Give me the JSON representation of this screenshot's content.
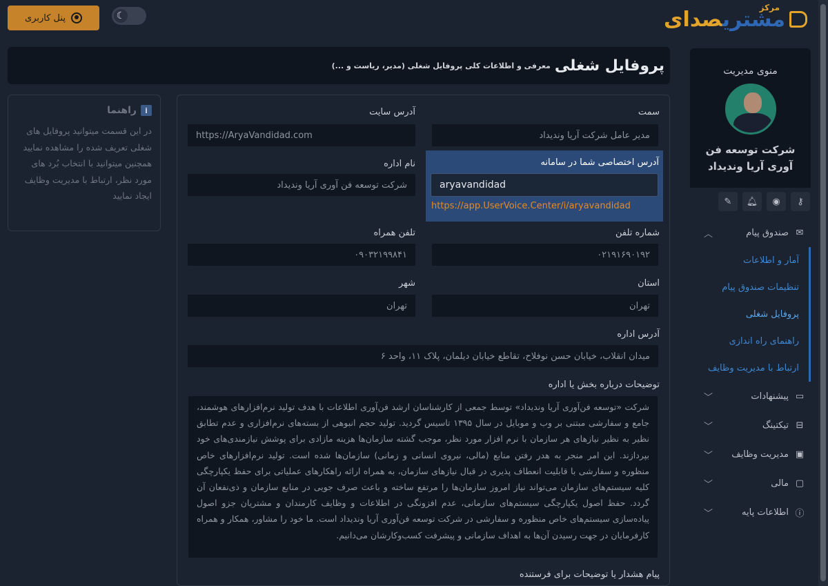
{
  "header": {
    "user_panel_label": "پنل کاربری",
    "logo_small": "مرکز",
    "logo_text_part1": "صدای",
    "logo_text_part2": "مشتری"
  },
  "page": {
    "title": "پروفایل شغلی",
    "subtitle": "معرفی و اطلاعات کلی پروفایل شغلی (مدیر، ریاست و ...)"
  },
  "sidebar": {
    "heading": "منوی مدیریت",
    "company_name": "شرکت توسعه فن آوری آریا وندیداد",
    "groups": [
      {
        "label": "صندوق پیام",
        "icon": "envelope-icon",
        "expanded": true
      },
      {
        "label": "پیشنهادات",
        "icon": "chat-icon"
      },
      {
        "label": "تیکتینگ",
        "icon": "ticket-icon"
      },
      {
        "label": "مدیریت وظایف",
        "icon": "task-icon"
      },
      {
        "label": "مالی",
        "icon": "money-icon"
      },
      {
        "label": "اطلاعات پایه",
        "icon": "info-icon"
      }
    ],
    "submenu": [
      "آمار و اطلاعات",
      "تنظیمات صندوق پیام",
      "پروفایل شغلی",
      "راهنمای راه اندازی",
      "ارتباط با مدیریت وظایف"
    ]
  },
  "help": {
    "title": "راهنما",
    "text": "در این قسمت میتوانید پروفایل های شغلی تعریف شده را مشاهده نمایید همچنین میتوانید با انتخاب بُرد های مورد نظر، ارتباط با مدیریت وظایف ایجاد نمایید"
  },
  "form": {
    "position_label": "سمت",
    "position_value": "مدیر عامل شرکت آریا وندیداد",
    "site_label": "آدرس سایت",
    "site_value": "https://AryaVandidad.com",
    "unique_address_label": "آدرس اختصاصی شما در سامانه",
    "unique_address_value": "aryavandidad",
    "unique_address_url": "https://app.UserVoice.Center/i/aryavandidad",
    "office_name_label": "نام اداره",
    "office_name_value": "شرکت توسعه فن آوری آریا وندیداد",
    "phone_label": "شماره تلفن",
    "phone_value": "۰۲۱۹۱۶۹۰۱۹۲",
    "mobile_label": "تلفن همراه",
    "mobile_value": "۰۹۰۳۲۱۹۹۸۴۱",
    "province_label": "استان",
    "province_value": "تهران",
    "city_label": "شهر",
    "city_value": "تهران",
    "office_address_label": "آدرس اداره",
    "office_address_value": "میدان انقلاب، خیابان حسن نوفلاح، تقاطع خیابان دیلمان، پلاک ۱۱، واحد ۶",
    "description_label": "توضیحات درباره بخش یا اداره",
    "description_value": "شرکت «توسعه فن‌آوری آریا وندیداد» توسط جمعی از کارشناسان ارشد فن‌آوری اطلاعات با هدف تولید نرم‌افزارهای هوشمند، جامع و سفارشی مبتنی بر وب و موبایل در سال ۱۳۹۵ تاسیس گردید. تولید حجم انبوهی از بسته‌های نرم‌افزاری و عدم تطابق نظیر به نظیر نیازهای هر سازمان با نرم افزار مورد نظر، موجب گشته سازمان‌ها هزینه مازادی برای پوشش نیازمندی‌های خود بپردازند. این امر منجر به هدر رفتن منابع (مالی، نیروی انسانی و زمانی) سازمان‌ها شده است. تولید نرم‌افزارهای خاص منظوره و سفارشی با قابلیت انعطاف پذیری در قبال نیازهای سازمان، به همراه ارائه راهکارهای عملیاتی برای حفظ یکپارچگی کلیه سیستم‌های سازمان می‌تواند نیاز امروز سازمان‌ها را مرتفع ساخته و باعث صرف جویی در منابع سازمان و ذی‌نفعان آن گردد. حفظ اصول یکپارچگی سیستم‌های سازمانی، عدم افزونگی در اطلاعات و وظایف کارمندان و مشتریان جزو اصول پیاده‌سازی سیستم‌های خاص منظوره و سفارشی در شرکت توسعه فن‌آوری آریا وندیداد است. ما خود را مشاور، همکار و همراه کارفرمایان در جهت رسیدن آن‌ها به اهداف سازمانی و پیشرفت کسب‌وکارشان می‌دانیم.",
    "warning_label": "پیام هشدار یا توضیحات برای فرستنده"
  }
}
